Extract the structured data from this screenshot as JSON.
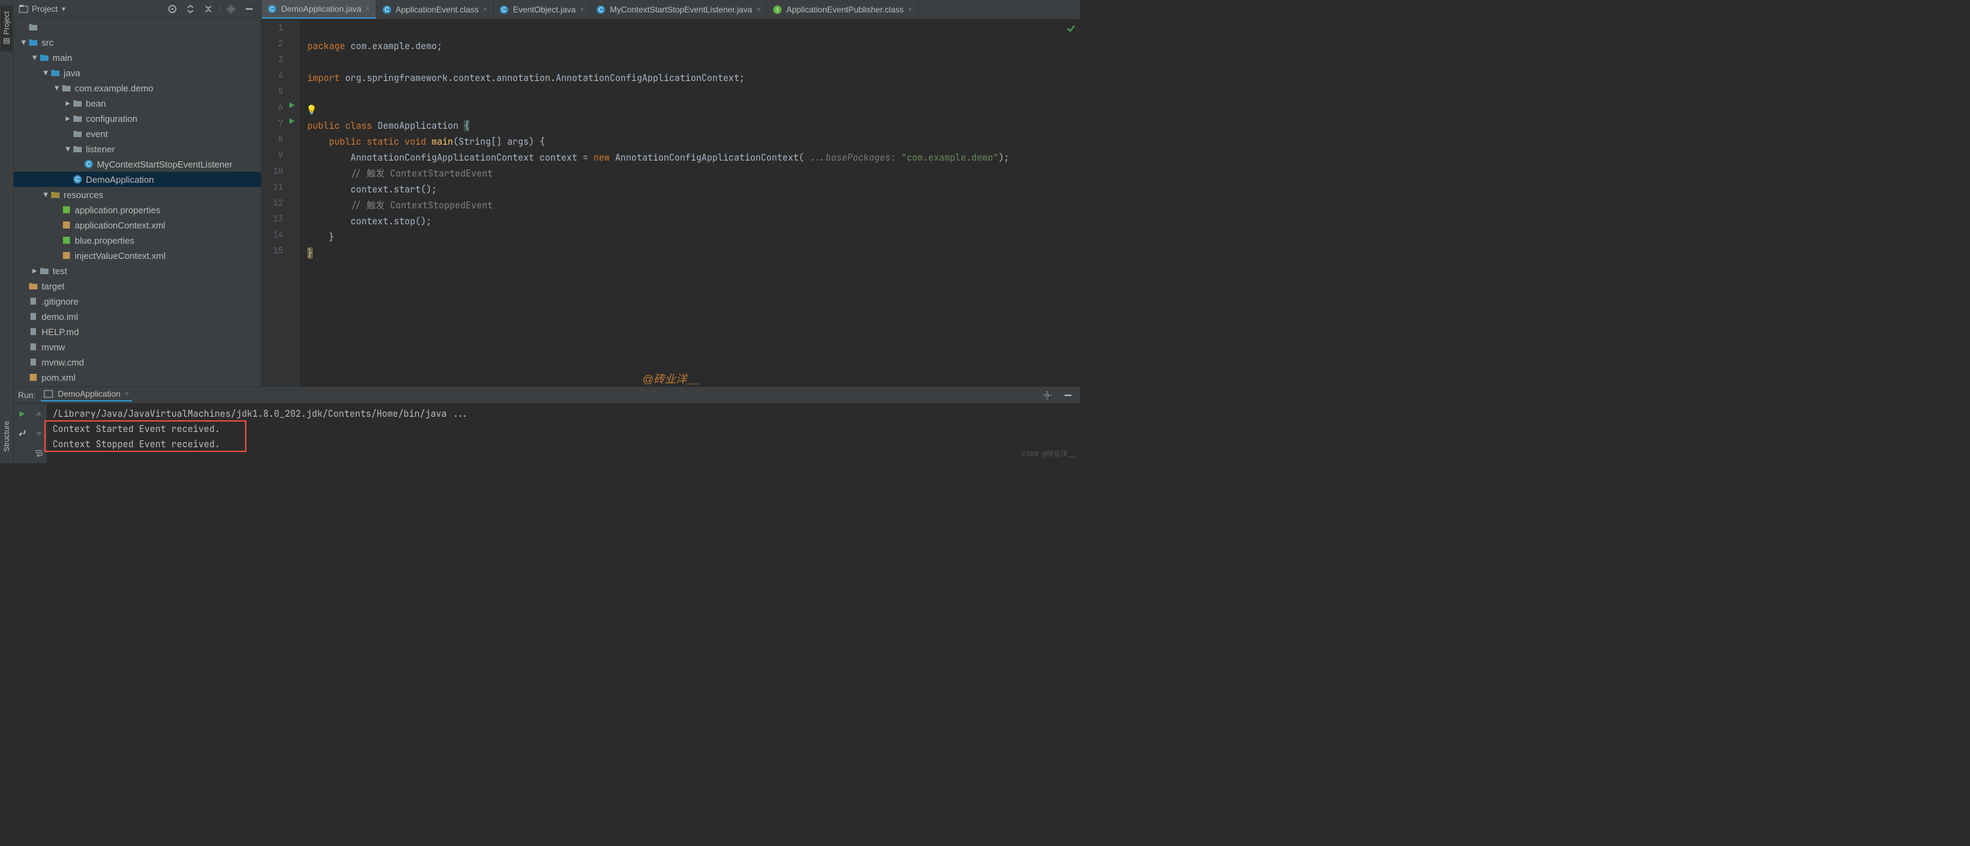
{
  "sidebar": {
    "project_tab": "Project",
    "structure_tab": "Structure"
  },
  "project_header": {
    "title": "Project"
  },
  "tree": [
    {
      "indent": 0,
      "chev": "",
      "icon": "folder",
      "label": ""
    },
    {
      "indent": 0,
      "chev": "down",
      "icon": "folder-blue",
      "label": "src"
    },
    {
      "indent": 1,
      "chev": "down",
      "icon": "folder-blue",
      "label": "main"
    },
    {
      "indent": 2,
      "chev": "down",
      "icon": "folder-blue",
      "label": "java"
    },
    {
      "indent": 3,
      "chev": "down",
      "icon": "folder",
      "label": "com.example.demo"
    },
    {
      "indent": 4,
      "chev": "right",
      "icon": "folder",
      "label": "bean"
    },
    {
      "indent": 4,
      "chev": "right",
      "icon": "folder",
      "label": "configuration"
    },
    {
      "indent": 4,
      "chev": "",
      "icon": "folder",
      "label": "event"
    },
    {
      "indent": 4,
      "chev": "down",
      "icon": "folder",
      "label": "listener"
    },
    {
      "indent": 5,
      "chev": "",
      "icon": "class",
      "label": "MyContextStartStopEventListener"
    },
    {
      "indent": 4,
      "chev": "",
      "icon": "class",
      "label": "DemoApplication",
      "selected": true
    },
    {
      "indent": 2,
      "chev": "down",
      "icon": "folder-res",
      "label": "resources"
    },
    {
      "indent": 3,
      "chev": "",
      "icon": "prop",
      "label": "application.properties"
    },
    {
      "indent": 3,
      "chev": "",
      "icon": "xml",
      "label": "applicationContext.xml"
    },
    {
      "indent": 3,
      "chev": "",
      "icon": "prop",
      "label": "blue.properties"
    },
    {
      "indent": 3,
      "chev": "",
      "icon": "xml",
      "label": "injectValueContext.xml"
    },
    {
      "indent": 1,
      "chev": "right",
      "icon": "folder",
      "label": "test"
    },
    {
      "indent": 0,
      "chev": "",
      "icon": "folder-orange",
      "label": "target"
    },
    {
      "indent": 0,
      "chev": "",
      "icon": "txt",
      "label": ".gitignore"
    },
    {
      "indent": 0,
      "chev": "",
      "icon": "txt",
      "label": "demo.iml"
    },
    {
      "indent": 0,
      "chev": "",
      "icon": "txt",
      "label": "HELP.md"
    },
    {
      "indent": 0,
      "chev": "",
      "icon": "txt",
      "label": "mvnw"
    },
    {
      "indent": 0,
      "chev": "",
      "icon": "txt",
      "label": "mvnw.cmd"
    },
    {
      "indent": 0,
      "chev": "",
      "icon": "xml",
      "label": "pom.xml"
    }
  ],
  "editor_tabs": [
    {
      "label": "DemoApplication.java",
      "active": true,
      "icon": "class"
    },
    {
      "label": "ApplicationEvent.class",
      "icon": "class"
    },
    {
      "label": "EventObject.java",
      "icon": "class"
    },
    {
      "label": "MyContextStartStopEventListener.java",
      "icon": "class"
    },
    {
      "label": "ApplicationEventPublisher.class",
      "icon": "interface"
    }
  ],
  "code": {
    "line1": {
      "a": "package",
      "b": " com.example.demo;"
    },
    "line3": {
      "a": "import",
      "b": " org.springframework.context.annotation.AnnotationConfigApplicationContext;"
    },
    "line6": {
      "a": "public class ",
      "b": "DemoApplication ",
      "c": "{"
    },
    "line7": {
      "a": "    public static void ",
      "b": "main",
      "c": "(String[] args) {"
    },
    "line8": {
      "a": "        AnnotationConfigApplicationContext context = ",
      "b": "new",
      "c": " AnnotationConfigApplicationContext( ",
      "hint": "...basePackages:",
      "d": " \"com.example.demo\"",
      "e": ");"
    },
    "line9": "        // 触发 ContextStartedEvent",
    "line10": "        context.start();",
    "line11": "        // 触发 ContextStoppedEvent",
    "line12": "        context.stop();",
    "line13": "    }",
    "line14": "}"
  },
  "line_numbers": [
    "1",
    "2",
    "3",
    "4",
    "5",
    "6",
    "7",
    "8",
    "9",
    "10",
    "11",
    "12",
    "13",
    "14",
    "15"
  ],
  "watermark": "@砖业洋__",
  "run": {
    "label": "Run:",
    "tab": "DemoApplication",
    "cmd": "/Library/Java/JavaVirtualMachines/jdk1.8.0_202.jdk/Contents/Home/bin/java ...",
    "out1": "Context Started Event received.",
    "out2": "Context Stopped Event received."
  },
  "footer": "CSDN @砖业洋__"
}
